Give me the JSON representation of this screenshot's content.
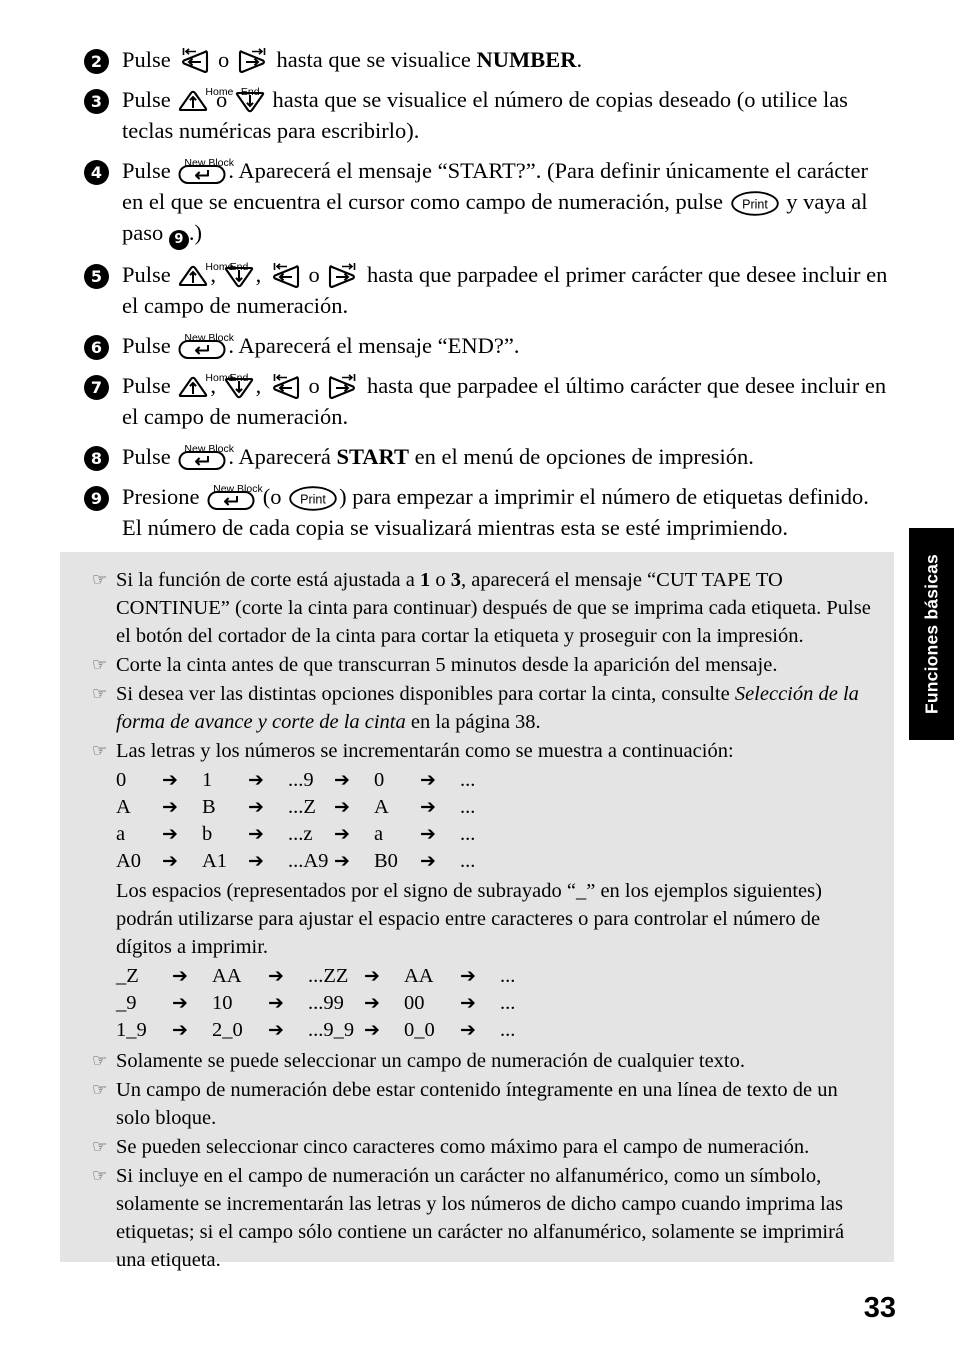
{
  "page": {
    "number": "33",
    "side_tab_label": "Funciones básicas"
  },
  "keys": {
    "left_arrow": "left-arrow-key",
    "right_arrow": "right-arrow-key",
    "up_arrow": "up-arrow-key",
    "down_arrow": "down-arrow-key",
    "enter": "new-block-enter-key",
    "print": "print-key",
    "label_home": "Home",
    "label_end": "End",
    "label_new_block": "New Block",
    "label_print": "Print"
  },
  "steps": [
    {
      "num": "2",
      "parts": [
        {
          "t": "text",
          "v": "Pulse "
        },
        {
          "t": "key",
          "v": "left_arrow"
        },
        {
          "t": "text",
          "v": " o "
        },
        {
          "t": "key",
          "v": "right_arrow"
        },
        {
          "t": "text",
          "v": " hasta que se visualice "
        },
        {
          "t": "bold",
          "v": "NUMBER"
        },
        {
          "t": "text",
          "v": "."
        }
      ]
    },
    {
      "num": "3",
      "parts": [
        {
          "t": "text",
          "v": "Pulse "
        },
        {
          "t": "key",
          "v": "up_arrow"
        },
        {
          "t": "text",
          "v": " o "
        },
        {
          "t": "key",
          "v": "down_arrow"
        },
        {
          "t": "text",
          "v": " hasta que se visualice el número de copias deseado (o utilice las teclas numéricas para escribirlo)."
        }
      ]
    },
    {
      "num": "4",
      "parts": [
        {
          "t": "text",
          "v": "Pulse "
        },
        {
          "t": "key",
          "v": "enter"
        },
        {
          "t": "text",
          "v": ". Aparecerá el mensaje “START?”. (Para definir únicamente el carácter en el que se encuentra el cursor como campo de numeración, pulse "
        },
        {
          "t": "key",
          "v": "print"
        },
        {
          "t": "text",
          "v": " y vaya al paso "
        },
        {
          "t": "circlenum",
          "v": "9"
        },
        {
          "t": "text",
          "v": ".)"
        }
      ]
    },
    {
      "num": "5",
      "parts": [
        {
          "t": "text",
          "v": "Pulse "
        },
        {
          "t": "key",
          "v": "up_arrow"
        },
        {
          "t": "text",
          "v": ", "
        },
        {
          "t": "key",
          "v": "down_arrow"
        },
        {
          "t": "text",
          "v": ", "
        },
        {
          "t": "key",
          "v": "left_arrow"
        },
        {
          "t": "text",
          "v": " o "
        },
        {
          "t": "key",
          "v": "right_arrow"
        },
        {
          "t": "text",
          "v": " hasta que parpadee el primer carácter que desee incluir en el campo de numeración."
        }
      ]
    },
    {
      "num": "6",
      "parts": [
        {
          "t": "text",
          "v": "Pulse "
        },
        {
          "t": "key",
          "v": "enter"
        },
        {
          "t": "text",
          "v": ". Aparecerá el mensaje “END?”."
        }
      ]
    },
    {
      "num": "7",
      "parts": [
        {
          "t": "text",
          "v": "Pulse "
        },
        {
          "t": "key",
          "v": "up_arrow"
        },
        {
          "t": "text",
          "v": ", "
        },
        {
          "t": "key",
          "v": "down_arrow"
        },
        {
          "t": "text",
          "v": ", "
        },
        {
          "t": "key",
          "v": "left_arrow"
        },
        {
          "t": "text",
          "v": " o "
        },
        {
          "t": "key",
          "v": "right_arrow"
        },
        {
          "t": "text",
          "v": " hasta que parpadee el último carácter que desee incluir en el campo de numeración."
        }
      ]
    },
    {
      "num": "8",
      "parts": [
        {
          "t": "text",
          "v": "Pulse "
        },
        {
          "t": "key",
          "v": "enter"
        },
        {
          "t": "text",
          "v": ". Aparecerá "
        },
        {
          "t": "bold",
          "v": "START"
        },
        {
          "t": "text",
          "v": " en el menú de opciones de impresión."
        }
      ]
    },
    {
      "num": "9",
      "parts": [
        {
          "t": "text",
          "v": "Presione "
        },
        {
          "t": "key",
          "v": "enter"
        },
        {
          "t": "text",
          "v": " (o "
        },
        {
          "t": "key",
          "v": "print"
        },
        {
          "t": "text",
          "v": ") para empezar a imprimir el número de etiquetas definido. El número de cada copia se visualizará mientras esta se esté imprimiendo."
        }
      ]
    }
  ],
  "notes": {
    "bullet_icon": "pointing-hand-icon",
    "bullet_glyph": "☞",
    "items": [
      {
        "type": "text",
        "parts": [
          {
            "t": "text",
            "v": "Si la función de corte está ajustada a "
          },
          {
            "t": "bold",
            "v": "1"
          },
          {
            "t": "text",
            "v": " o "
          },
          {
            "t": "bold",
            "v": "3"
          },
          {
            "t": "text",
            "v": ", aparecerá el mensaje “CUT TAPE TO CONTINUE” (corte la cinta para continuar) después de que se imprima cada etiqueta. Pulse el botón del cortador de la cinta para cortar la etiqueta y proseguir con la impresión."
          }
        ]
      },
      {
        "type": "text",
        "parts": [
          {
            "t": "text",
            "v": "Corte la cinta antes de que transcurran 5 minutos desde la aparición del mensaje."
          }
        ]
      },
      {
        "type": "text",
        "parts": [
          {
            "t": "text",
            "v": "Si desea ver las distintas opciones disponibles para cortar la cinta, consulte "
          },
          {
            "t": "italic",
            "v": "Selección de la forma de avance y corte de la cinta"
          },
          {
            "t": "text",
            "v": " en la página 38."
          }
        ]
      },
      {
        "type": "sequence",
        "parts": [
          {
            "t": "text",
            "v": "Las letras y los números se incrementarán como se muestra a continuación:"
          }
        ],
        "sequences": [
          [
            "0",
            "1",
            "...9",
            "0",
            "..."
          ],
          [
            "A",
            "B",
            "...Z",
            "A",
            "..."
          ],
          [
            "a",
            "b",
            "...z",
            "a",
            "..."
          ],
          [
            "A0",
            "A1",
            "...A9",
            "B0",
            "..."
          ]
        ],
        "paragraph": "Los espacios (representados por el signo de subrayado “_” en los ejemplos siguientes) podrán utilizarse para ajustar el espacio entre caracteres o para controlar el número de dígitos a imprimir.",
        "sequences2": [
          [
            "_Z",
            "AA",
            "...ZZ",
            "AA",
            "..."
          ],
          [
            "_9",
            "10",
            "...99",
            "00",
            "..."
          ],
          [
            "1_9",
            "2_0",
            "...9_9",
            "0_0",
            "..."
          ]
        ],
        "arrow_glyph": "➔"
      },
      {
        "type": "text",
        "parts": [
          {
            "t": "text",
            "v": "Solamente se puede seleccionar un campo de numeración de cualquier texto."
          }
        ]
      },
      {
        "type": "text",
        "parts": [
          {
            "t": "text",
            "v": "Un campo de numeración debe estar contenido íntegramente en una línea de texto de un solo bloque."
          }
        ]
      },
      {
        "type": "text",
        "parts": [
          {
            "t": "text",
            "v": "Se pueden seleccionar cinco caracteres como máximo para el campo de numeración."
          }
        ]
      },
      {
        "type": "text",
        "parts": [
          {
            "t": "text",
            "v": "Si incluye en el campo de numeración un carácter no alfanumérico, como un símbolo, solamente se incrementarán las letras y los números de dicho campo cuando imprima las etiquetas; si el campo sólo contiene un carácter no alfanumérico, solamente se imprimirá una etiqueta."
          }
        ]
      }
    ]
  }
}
